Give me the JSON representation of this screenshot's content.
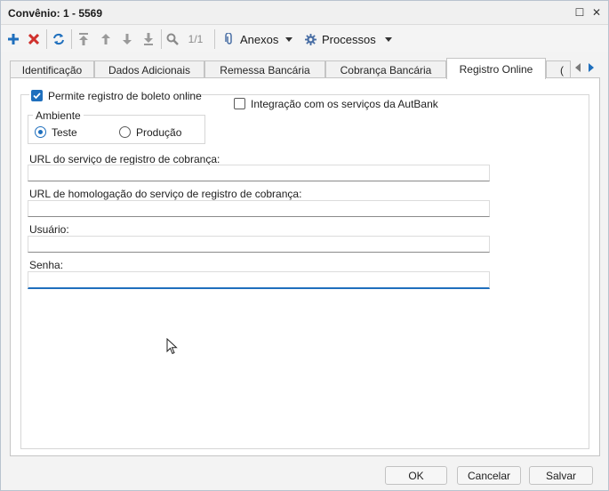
{
  "window": {
    "title": "Convênio: 1 - 5569",
    "restore_glyph": "☐",
    "close_glyph": "✕"
  },
  "toolbar": {
    "page_indicator": "1/1",
    "anexos_label": "Anexos",
    "processos_label": "Processos",
    "icons": [
      "add-icon",
      "delete-icon",
      "refresh-icon",
      "first-icon",
      "previous-icon",
      "next-icon",
      "last-icon",
      "search-icon",
      "paperclip-icon",
      "gear-icon"
    ]
  },
  "tabs": [
    {
      "label": "Identificação",
      "active": false
    },
    {
      "label": "Dados Adicionais",
      "active": false
    },
    {
      "label": "Remessa Bancária",
      "active": false
    },
    {
      "label": "Cobrança Bancária",
      "active": false
    },
    {
      "label": "Registro Online",
      "active": true
    },
    {
      "label": "(",
      "active": false
    }
  ],
  "form": {
    "permite_registro_label": "Permite registro de boleto online",
    "permite_registro_checked": true,
    "integracao_label": "Integração com os serviços da AutBank",
    "integracao_checked": false,
    "ambiente": {
      "legend": "Ambiente",
      "options": [
        {
          "label": "Teste",
          "selected": true
        },
        {
          "label": "Produção",
          "selected": false
        }
      ]
    },
    "url_registro": {
      "label": "URL do serviço de registro de cobrança:",
      "value": ""
    },
    "url_homologacao": {
      "label": "URL de homologação do serviço de registro de cobrança:",
      "value": ""
    },
    "usuario": {
      "label": "Usuário:",
      "value": ""
    },
    "senha": {
      "label": "Senha:",
      "value": ""
    }
  },
  "footer": {
    "ok_label": "OK",
    "cancel_label": "Cancelar",
    "save_label": "Salvar"
  },
  "colors": {
    "accent": "#1f6fbd",
    "add": "#1f6fbd",
    "delete": "#d0312d"
  }
}
